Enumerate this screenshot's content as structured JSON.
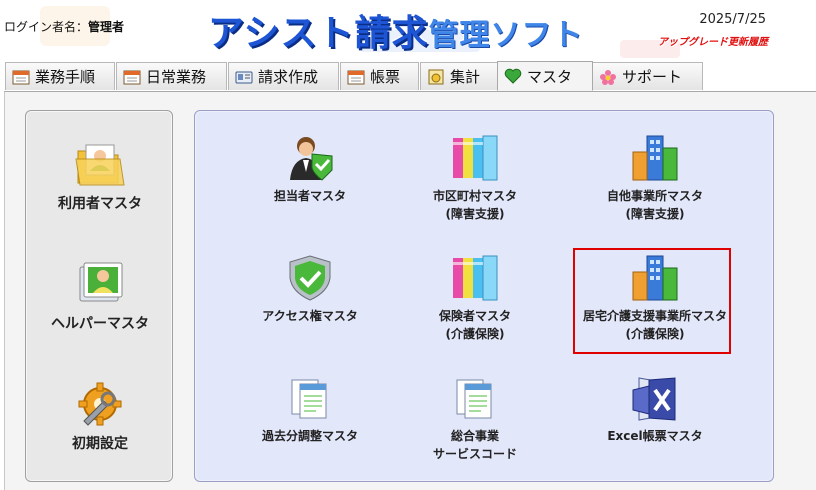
{
  "header": {
    "login_label": "ログイン者名：",
    "login_user": "管理者",
    "title_part1": "アシスト請求",
    "title_part2": "管理ソフト",
    "date": "2025/7/25",
    "update_link": "アップグレード更新履歴"
  },
  "tabs": [
    {
      "label": "業務手順",
      "icon": "calendar-icon"
    },
    {
      "label": "日常業務",
      "icon": "calendar-icon"
    },
    {
      "label": "請求作成",
      "icon": "id-card-icon"
    },
    {
      "label": "帳票",
      "icon": "calendar-icon"
    },
    {
      "label": "集計",
      "icon": "ledger-icon"
    },
    {
      "label": "マスタ",
      "icon": "heart-icon",
      "active": true
    },
    {
      "label": "サポート",
      "icon": "flower-icon"
    }
  ],
  "left_items": [
    {
      "label": "利用者マスタ",
      "icon": "user-folder-icon"
    },
    {
      "label": "ヘルパーマスタ",
      "icon": "user-card-icon"
    },
    {
      "label": "初期設定",
      "icon": "wrench-gear-icon"
    }
  ],
  "right_items": [
    {
      "line1": "担当者マスタ",
      "line2": "",
      "icon": "staff-check-icon"
    },
    {
      "line1": "市区町村マスタ",
      "line2": "(障害支援)",
      "icon": "binders-icon"
    },
    {
      "line1": "自他事業所マスタ",
      "line2": "(障害支援)",
      "icon": "buildings-icon"
    },
    {
      "line1": "アクセス権マスタ",
      "line2": "",
      "icon": "shield-check-icon"
    },
    {
      "line1": "保険者マスタ",
      "line2": "(介護保険)",
      "icon": "binders-icon"
    },
    {
      "line1": "居宅介護支援事業所マスタ",
      "line2": "(介護保険)",
      "icon": "buildings-icon"
    },
    {
      "line1": "過去分調整マスタ",
      "line2": "",
      "icon": "documents-icon"
    },
    {
      "line1": "総合事業",
      "line2": "サービスコード",
      "icon": "documents-icon"
    },
    {
      "line1": "Excel帳票マスタ",
      "line2": "",
      "icon": "excel-icon"
    }
  ],
  "colors": {
    "title_blue": "#1d55d4",
    "panel_blue": "#e3e7fa",
    "highlight_red": "#e00000"
  }
}
